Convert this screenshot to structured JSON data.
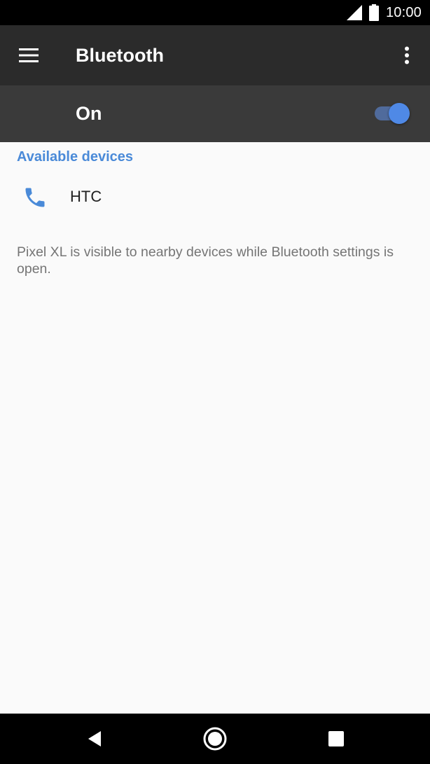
{
  "status_bar": {
    "time": "10:00",
    "icons": [
      "cell-signal-icon",
      "battery-icon"
    ]
  },
  "app_bar": {
    "title": "Bluetooth",
    "icons": [
      "menu-icon",
      "more-vert-icon"
    ]
  },
  "bluetooth_toggle": {
    "label": "On",
    "state": true
  },
  "available_devices": {
    "header": "Available devices",
    "items": [
      {
        "name": "HTC",
        "icon": "phone-icon"
      }
    ]
  },
  "footer": {
    "text": "Pixel XL is visible to nearby devices while Bluetooth settings is open."
  },
  "nav_bar": {
    "icons": [
      "back-icon",
      "home-icon",
      "recents-icon"
    ]
  },
  "colors": {
    "accent": "#4a8ad8",
    "toggle_thumb": "#4f89e6",
    "app_bar": "#2b2b2b",
    "switch_bar": "#3a3a3a"
  }
}
